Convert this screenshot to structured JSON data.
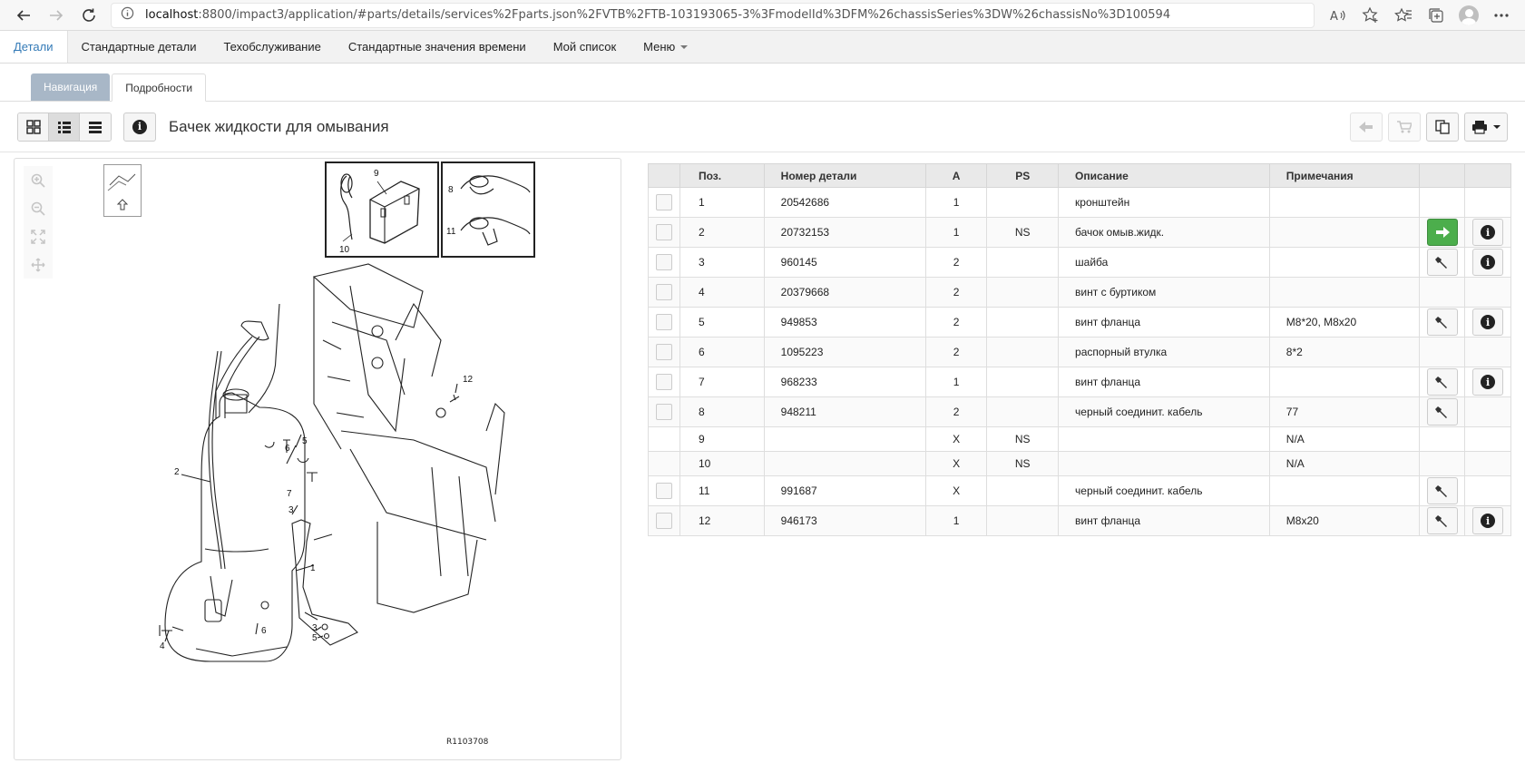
{
  "browser": {
    "url_host": "localhost",
    "url_rest": ":8800/impact3/application/#parts/details/services%2Fparts.json%2FVTB%2FTB-103193065-3%3FmodelId%3DFM%26chassisSeries%3DW%26chassisNo%3D100594"
  },
  "menu": {
    "items": [
      "Детали",
      "Стандартные детали",
      "Техобслуживание",
      "Стандартные значения времени",
      "Мой список",
      "Меню"
    ]
  },
  "tabs": {
    "nav": "Навигация",
    "details": "Подробности"
  },
  "page": {
    "title": "Бачек жидкости для омывания"
  },
  "diagram": {
    "ref_code": "R1103708",
    "labels": [
      "1",
      "2",
      "3",
      "4",
      "5",
      "6",
      "7",
      "8",
      "9",
      "10",
      "11",
      "12"
    ]
  },
  "table": {
    "headers": [
      "Поз.",
      "Номер детали",
      "A",
      "PS",
      "Описание",
      "Примечания"
    ],
    "rows": [
      {
        "pos": "1",
        "part": "20542686",
        "a": "1",
        "ps": "",
        "desc": "кронштейн",
        "note": "",
        "check": true,
        "tool": false,
        "go": false,
        "info": false
      },
      {
        "pos": "2",
        "part": "20732153",
        "a": "1",
        "ps": "NS",
        "desc": "бачок омыв.жидк.",
        "note": "",
        "check": true,
        "tool": false,
        "go": true,
        "info": true
      },
      {
        "pos": "3",
        "part": "960145",
        "a": "2",
        "ps": "",
        "desc": "шайба",
        "note": "",
        "check": true,
        "tool": true,
        "go": false,
        "info": true
      },
      {
        "pos": "4",
        "part": "20379668",
        "a": "2",
        "ps": "",
        "desc": "винт с буртиком",
        "note": "",
        "check": true,
        "tool": false,
        "go": false,
        "info": false
      },
      {
        "pos": "5",
        "part": "949853",
        "a": "2",
        "ps": "",
        "desc": "винт фланца",
        "note": "M8*20, M8x20",
        "check": true,
        "tool": true,
        "go": false,
        "info": true
      },
      {
        "pos": "6",
        "part": "1095223",
        "a": "2",
        "ps": "",
        "desc": "распорный втулка",
        "note": "8*2",
        "check": true,
        "tool": false,
        "go": false,
        "info": false
      },
      {
        "pos": "7",
        "part": "968233",
        "a": "1",
        "ps": "",
        "desc": "винт фланца",
        "note": "",
        "check": true,
        "tool": true,
        "go": false,
        "info": true
      },
      {
        "pos": "8",
        "part": "948211",
        "a": "2",
        "ps": "",
        "desc": "черный соединит. кабель",
        "note": "77",
        "check": true,
        "tool": true,
        "go": false,
        "info": false
      },
      {
        "pos": "9",
        "part": "",
        "a": "X",
        "ps": "NS",
        "desc": "",
        "note": "N/A",
        "check": false,
        "tool": false,
        "go": false,
        "info": false
      },
      {
        "pos": "10",
        "part": "",
        "a": "X",
        "ps": "NS",
        "desc": "",
        "note": "N/A",
        "check": false,
        "tool": false,
        "go": false,
        "info": false
      },
      {
        "pos": "11",
        "part": "991687",
        "a": "X",
        "ps": "",
        "desc": "черный соединит. кабель",
        "note": "",
        "check": true,
        "tool": true,
        "go": false,
        "info": false
      },
      {
        "pos": "12",
        "part": "946173",
        "a": "1",
        "ps": "",
        "desc": "винт фланца",
        "note": "M8x20",
        "check": true,
        "tool": true,
        "go": false,
        "info": true
      }
    ]
  }
}
